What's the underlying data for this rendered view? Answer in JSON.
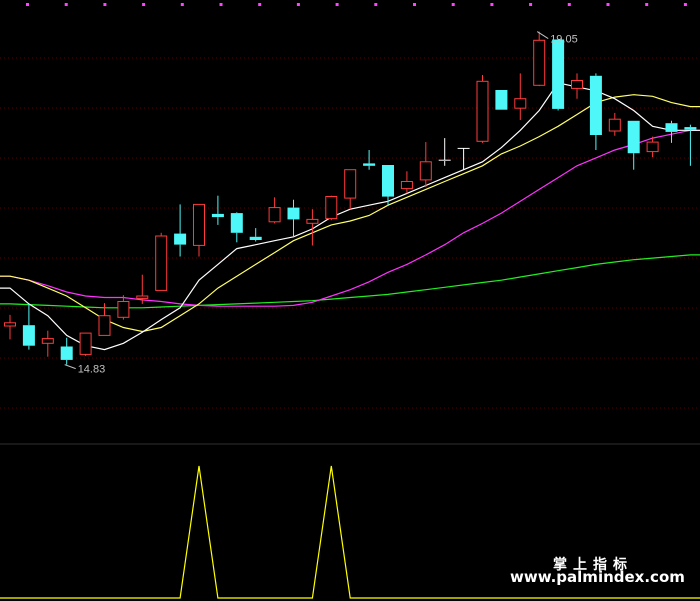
{
  "colors": {
    "background": "#000000",
    "grid": "#5a0000",
    "up": "#ff3b3b",
    "down": "#4ff8f8",
    "doji": "#ffffff",
    "ma_short": "#ffffff",
    "ma_mid": "#ffff66",
    "ma_long": "#ff33ff",
    "ma_longest": "#22ee22",
    "indicator": "#ffff00",
    "label": "#c0c0c0",
    "top_markers": "#ff44ff"
  },
  "watermark": {
    "chinese": "掌上指标",
    "url": "www.palmindex.com"
  },
  "chart_data": {
    "type": "candlestick",
    "title": "",
    "xlabel": "",
    "ylabel": "",
    "ylim": [
      13.9,
      19.4
    ],
    "grid": true,
    "annotations": {
      "max": {
        "label": "19.05",
        "index": 28,
        "value": 19.05
      },
      "min": {
        "label": "14.83",
        "index": 3,
        "value": 14.83
      }
    },
    "candles": [
      {
        "o": 15.32,
        "h": 15.46,
        "l": 15.15,
        "c": 15.36
      },
      {
        "o": 15.33,
        "h": 15.6,
        "l": 15.02,
        "c": 15.07
      },
      {
        "o": 15.1,
        "h": 15.26,
        "l": 14.93,
        "c": 15.16
      },
      {
        "o": 15.06,
        "h": 15.17,
        "l": 14.83,
        "c": 14.89
      },
      {
        "o": 14.96,
        "h": 15.23,
        "l": 14.94,
        "c": 15.23
      },
      {
        "o": 15.2,
        "h": 15.61,
        "l": 15.2,
        "c": 15.45
      },
      {
        "o": 15.43,
        "h": 15.71,
        "l": 15.4,
        "c": 15.63
      },
      {
        "o": 15.67,
        "h": 15.97,
        "l": 15.6,
        "c": 15.7
      },
      {
        "o": 15.77,
        "h": 16.5,
        "l": 15.77,
        "c": 16.46
      },
      {
        "o": 16.49,
        "h": 16.86,
        "l": 16.2,
        "c": 16.35
      },
      {
        "o": 16.34,
        "h": 16.86,
        "l": 16.2,
        "c": 16.86
      },
      {
        "o": 16.74,
        "h": 16.97,
        "l": 16.6,
        "c": 16.7
      },
      {
        "o": 16.75,
        "h": 16.76,
        "l": 16.38,
        "c": 16.5
      },
      {
        "o": 16.45,
        "h": 16.56,
        "l": 16.39,
        "c": 16.41
      },
      {
        "o": 16.64,
        "h": 16.95,
        "l": 16.62,
        "c": 16.82
      },
      {
        "o": 16.82,
        "h": 16.92,
        "l": 16.45,
        "c": 16.67
      },
      {
        "o": 16.62,
        "h": 16.8,
        "l": 16.34,
        "c": 16.67
      },
      {
        "o": 16.68,
        "h": 16.97,
        "l": 16.66,
        "c": 16.96
      },
      {
        "o": 16.94,
        "h": 17.28,
        "l": 16.8,
        "c": 17.3
      },
      {
        "o": 17.38,
        "h": 17.55,
        "l": 17.3,
        "c": 17.35
      },
      {
        "o": 17.36,
        "h": 17.36,
        "l": 16.84,
        "c": 16.96
      },
      {
        "o": 17.06,
        "h": 17.28,
        "l": 17.0,
        "c": 17.15
      },
      {
        "o": 17.17,
        "h": 17.65,
        "l": 17.08,
        "c": 17.4
      },
      {
        "o": 17.41,
        "h": 17.7,
        "l": 17.35,
        "c": 17.42
      },
      {
        "o": 17.57,
        "h": 17.57,
        "l": 17.3,
        "c": 17.57
      },
      {
        "o": 17.66,
        "h": 18.5,
        "l": 17.64,
        "c": 18.42
      },
      {
        "o": 18.31,
        "h": 18.31,
        "l": 18.06,
        "c": 18.06
      },
      {
        "o": 18.08,
        "h": 18.52,
        "l": 17.93,
        "c": 18.2
      },
      {
        "o": 18.37,
        "h": 19.05,
        "l": 18.36,
        "c": 18.94
      },
      {
        "o": 18.95,
        "h": 18.95,
        "l": 18.05,
        "c": 18.07
      },
      {
        "o": 18.33,
        "h": 18.52,
        "l": 18.2,
        "c": 18.43
      },
      {
        "o": 18.49,
        "h": 18.52,
        "l": 17.55,
        "c": 17.74
      },
      {
        "o": 17.79,
        "h": 18.02,
        "l": 17.73,
        "c": 17.94
      },
      {
        "o": 17.92,
        "h": 17.92,
        "l": 17.3,
        "c": 17.51
      },
      {
        "o": 17.53,
        "h": 17.72,
        "l": 17.46,
        "c": 17.65
      },
      {
        "o": 17.89,
        "h": 17.92,
        "l": 17.64,
        "c": 17.78
      },
      {
        "o": 17.84,
        "h": 17.87,
        "l": 17.35,
        "c": 17.81
      }
    ],
    "ma_short": [
      15.8,
      15.6,
      15.45,
      15.2,
      15.07,
      15.02,
      15.1,
      15.24,
      15.4,
      15.55,
      15.9,
      16.1,
      16.3,
      16.35,
      16.4,
      16.45,
      16.55,
      16.7,
      16.8,
      16.85,
      16.9,
      17.0,
      17.1,
      17.2,
      17.3,
      17.4,
      17.58,
      17.8,
      18.05,
      18.4,
      18.35,
      18.3,
      18.2,
      18.05,
      17.85,
      17.8,
      17.8
    ],
    "ma_mid": [
      15.95,
      15.9,
      15.8,
      15.7,
      15.55,
      15.4,
      15.3,
      15.25,
      15.3,
      15.45,
      15.6,
      15.8,
      15.95,
      16.1,
      16.25,
      16.4,
      16.5,
      16.6,
      16.65,
      16.72,
      16.85,
      16.95,
      17.05,
      17.15,
      17.25,
      17.35,
      17.5,
      17.6,
      17.72,
      17.85,
      18.0,
      18.15,
      18.22,
      18.25,
      18.23,
      18.15,
      18.1
    ],
    "ma_long": [
      15.95,
      15.9,
      15.83,
      15.75,
      15.7,
      15.68,
      15.68,
      15.65,
      15.63,
      15.6,
      15.58,
      15.57,
      15.57,
      15.57,
      15.57,
      15.58,
      15.62,
      15.7,
      15.78,
      15.88,
      16.0,
      16.1,
      16.22,
      16.35,
      16.5,
      16.62,
      16.75,
      16.9,
      17.05,
      17.2,
      17.35,
      17.45,
      17.55,
      17.62,
      17.7,
      17.75,
      17.8
    ],
    "ma_longest": [
      15.6,
      15.59,
      15.58,
      15.57,
      15.56,
      15.55,
      15.55,
      15.55,
      15.56,
      15.57,
      15.58,
      15.59,
      15.6,
      15.61,
      15.62,
      15.63,
      15.64,
      15.66,
      15.68,
      15.7,
      15.72,
      15.75,
      15.78,
      15.81,
      15.84,
      15.87,
      15.9,
      15.94,
      15.98,
      16.02,
      16.06,
      16.1,
      16.13,
      16.16,
      16.18,
      16.2,
      16.22
    ],
    "indicator": {
      "ylim": [
        0,
        1
      ],
      "values": [
        0,
        0,
        0,
        0,
        0,
        0,
        0,
        0,
        0,
        0,
        1,
        0,
        0,
        0,
        0,
        0,
        0,
        1,
        0,
        0,
        0,
        0,
        0,
        0,
        0,
        0,
        0,
        0,
        0,
        0,
        0,
        0,
        0,
        0,
        0,
        0,
        0
      ]
    }
  }
}
